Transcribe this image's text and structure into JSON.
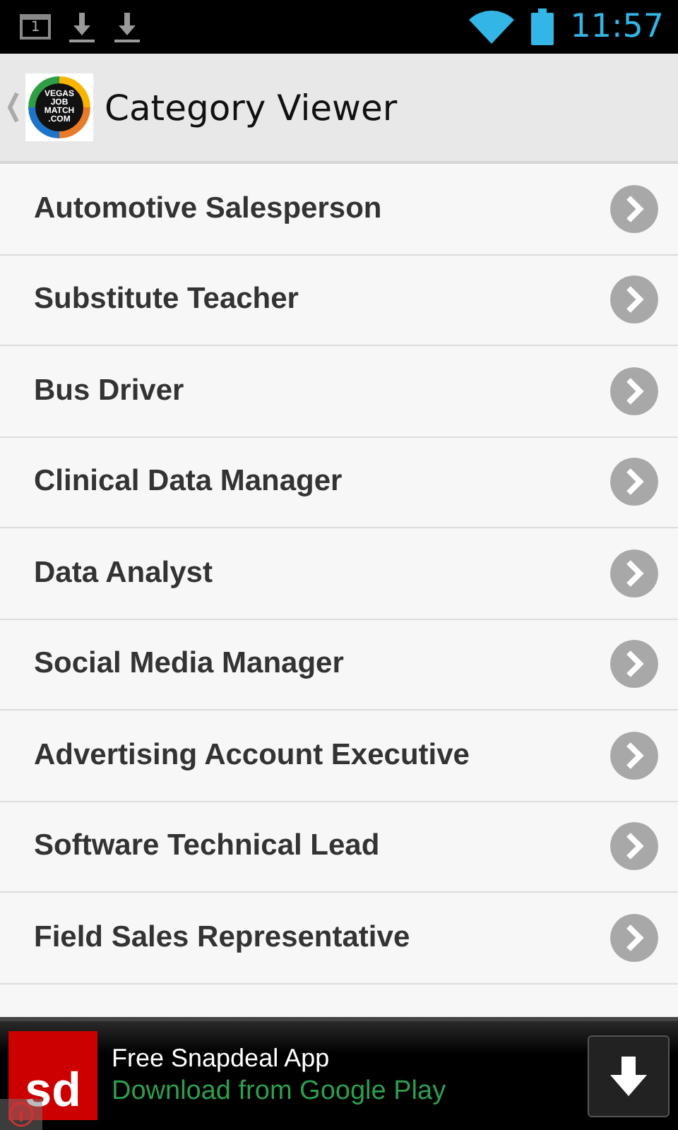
{
  "status_bar": {
    "time": "11:57",
    "notification_badge": "1"
  },
  "action_bar": {
    "title": "Category Viewer",
    "logo_text": [
      "VEGAS",
      "JOB",
      "MATCH",
      ".COM"
    ]
  },
  "categories": [
    {
      "label": "Automotive Salesperson"
    },
    {
      "label": "Substitute Teacher"
    },
    {
      "label": "Bus Driver"
    },
    {
      "label": "Clinical Data Manager"
    },
    {
      "label": "Data Analyst"
    },
    {
      "label": "Social Media Manager"
    },
    {
      "label": "Advertising Account Executive"
    },
    {
      "label": "Software Technical Lead"
    },
    {
      "label": "Field Sales Representative"
    }
  ],
  "ad": {
    "title": "Free Snapdeal App",
    "subtitle": "Download from Google Play",
    "logo": "sd"
  }
}
